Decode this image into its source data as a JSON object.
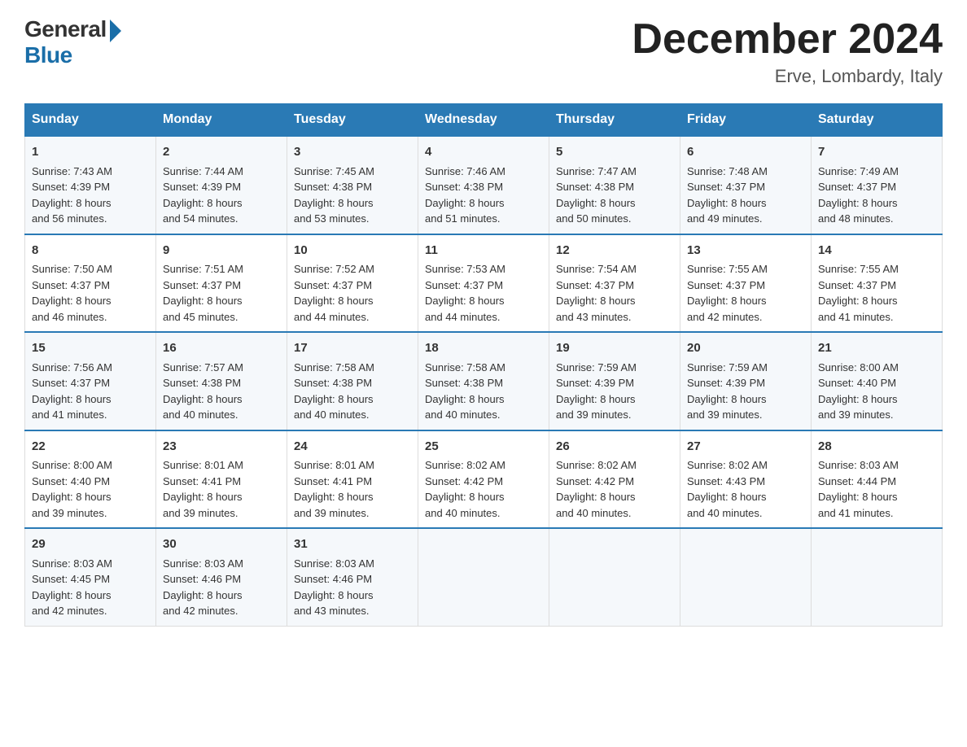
{
  "logo": {
    "general": "General",
    "blue": "Blue"
  },
  "title": "December 2024",
  "subtitle": "Erve, Lombardy, Italy",
  "days": [
    "Sunday",
    "Monday",
    "Tuesday",
    "Wednesday",
    "Thursday",
    "Friday",
    "Saturday"
  ],
  "weeks": [
    [
      {
        "day": "1",
        "sunrise": "7:43 AM",
        "sunset": "4:39 PM",
        "daylight": "8 hours and 56 minutes."
      },
      {
        "day": "2",
        "sunrise": "7:44 AM",
        "sunset": "4:39 PM",
        "daylight": "8 hours and 54 minutes."
      },
      {
        "day": "3",
        "sunrise": "7:45 AM",
        "sunset": "4:38 PM",
        "daylight": "8 hours and 53 minutes."
      },
      {
        "day": "4",
        "sunrise": "7:46 AM",
        "sunset": "4:38 PM",
        "daylight": "8 hours and 51 minutes."
      },
      {
        "day": "5",
        "sunrise": "7:47 AM",
        "sunset": "4:38 PM",
        "daylight": "8 hours and 50 minutes."
      },
      {
        "day": "6",
        "sunrise": "7:48 AM",
        "sunset": "4:37 PM",
        "daylight": "8 hours and 49 minutes."
      },
      {
        "day": "7",
        "sunrise": "7:49 AM",
        "sunset": "4:37 PM",
        "daylight": "8 hours and 48 minutes."
      }
    ],
    [
      {
        "day": "8",
        "sunrise": "7:50 AM",
        "sunset": "4:37 PM",
        "daylight": "8 hours and 46 minutes."
      },
      {
        "day": "9",
        "sunrise": "7:51 AM",
        "sunset": "4:37 PM",
        "daylight": "8 hours and 45 minutes."
      },
      {
        "day": "10",
        "sunrise": "7:52 AM",
        "sunset": "4:37 PM",
        "daylight": "8 hours and 44 minutes."
      },
      {
        "day": "11",
        "sunrise": "7:53 AM",
        "sunset": "4:37 PM",
        "daylight": "8 hours and 44 minutes."
      },
      {
        "day": "12",
        "sunrise": "7:54 AM",
        "sunset": "4:37 PM",
        "daylight": "8 hours and 43 minutes."
      },
      {
        "day": "13",
        "sunrise": "7:55 AM",
        "sunset": "4:37 PM",
        "daylight": "8 hours and 42 minutes."
      },
      {
        "day": "14",
        "sunrise": "7:55 AM",
        "sunset": "4:37 PM",
        "daylight": "8 hours and 41 minutes."
      }
    ],
    [
      {
        "day": "15",
        "sunrise": "7:56 AM",
        "sunset": "4:37 PM",
        "daylight": "8 hours and 41 minutes."
      },
      {
        "day": "16",
        "sunrise": "7:57 AM",
        "sunset": "4:38 PM",
        "daylight": "8 hours and 40 minutes."
      },
      {
        "day": "17",
        "sunrise": "7:58 AM",
        "sunset": "4:38 PM",
        "daylight": "8 hours and 40 minutes."
      },
      {
        "day": "18",
        "sunrise": "7:58 AM",
        "sunset": "4:38 PM",
        "daylight": "8 hours and 40 minutes."
      },
      {
        "day": "19",
        "sunrise": "7:59 AM",
        "sunset": "4:39 PM",
        "daylight": "8 hours and 39 minutes."
      },
      {
        "day": "20",
        "sunrise": "7:59 AM",
        "sunset": "4:39 PM",
        "daylight": "8 hours and 39 minutes."
      },
      {
        "day": "21",
        "sunrise": "8:00 AM",
        "sunset": "4:40 PM",
        "daylight": "8 hours and 39 minutes."
      }
    ],
    [
      {
        "day": "22",
        "sunrise": "8:00 AM",
        "sunset": "4:40 PM",
        "daylight": "8 hours and 39 minutes."
      },
      {
        "day": "23",
        "sunrise": "8:01 AM",
        "sunset": "4:41 PM",
        "daylight": "8 hours and 39 minutes."
      },
      {
        "day": "24",
        "sunrise": "8:01 AM",
        "sunset": "4:41 PM",
        "daylight": "8 hours and 39 minutes."
      },
      {
        "day": "25",
        "sunrise": "8:02 AM",
        "sunset": "4:42 PM",
        "daylight": "8 hours and 40 minutes."
      },
      {
        "day": "26",
        "sunrise": "8:02 AM",
        "sunset": "4:42 PM",
        "daylight": "8 hours and 40 minutes."
      },
      {
        "day": "27",
        "sunrise": "8:02 AM",
        "sunset": "4:43 PM",
        "daylight": "8 hours and 40 minutes."
      },
      {
        "day": "28",
        "sunrise": "8:03 AM",
        "sunset": "4:44 PM",
        "daylight": "8 hours and 41 minutes."
      }
    ],
    [
      {
        "day": "29",
        "sunrise": "8:03 AM",
        "sunset": "4:45 PM",
        "daylight": "8 hours and 42 minutes."
      },
      {
        "day": "30",
        "sunrise": "8:03 AM",
        "sunset": "4:46 PM",
        "daylight": "8 hours and 42 minutes."
      },
      {
        "day": "31",
        "sunrise": "8:03 AM",
        "sunset": "4:46 PM",
        "daylight": "8 hours and 43 minutes."
      },
      null,
      null,
      null,
      null
    ]
  ],
  "labels": {
    "sunrise": "Sunrise:",
    "sunset": "Sunset:",
    "daylight": "Daylight:"
  }
}
